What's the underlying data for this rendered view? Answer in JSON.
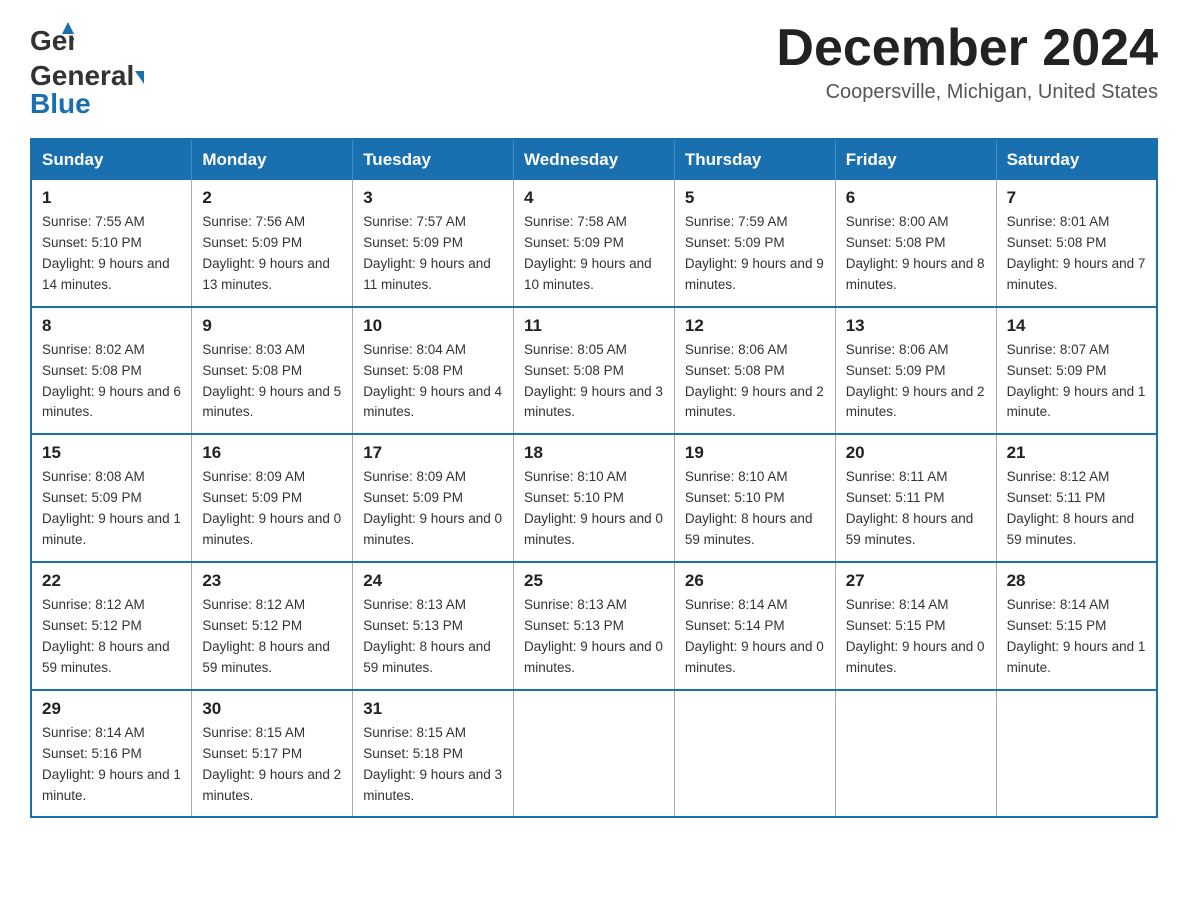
{
  "header": {
    "logo_general": "General",
    "logo_blue": "Blue",
    "month_title": "December 2024",
    "location": "Coopersville, Michigan, United States"
  },
  "weekdays": [
    "Sunday",
    "Monday",
    "Tuesday",
    "Wednesday",
    "Thursday",
    "Friday",
    "Saturday"
  ],
  "weeks": [
    [
      {
        "day": "1",
        "sunrise": "Sunrise: 7:55 AM",
        "sunset": "Sunset: 5:10 PM",
        "daylight": "Daylight: 9 hours and 14 minutes."
      },
      {
        "day": "2",
        "sunrise": "Sunrise: 7:56 AM",
        "sunset": "Sunset: 5:09 PM",
        "daylight": "Daylight: 9 hours and 13 minutes."
      },
      {
        "day": "3",
        "sunrise": "Sunrise: 7:57 AM",
        "sunset": "Sunset: 5:09 PM",
        "daylight": "Daylight: 9 hours and 11 minutes."
      },
      {
        "day": "4",
        "sunrise": "Sunrise: 7:58 AM",
        "sunset": "Sunset: 5:09 PM",
        "daylight": "Daylight: 9 hours and 10 minutes."
      },
      {
        "day": "5",
        "sunrise": "Sunrise: 7:59 AM",
        "sunset": "Sunset: 5:09 PM",
        "daylight": "Daylight: 9 hours and 9 minutes."
      },
      {
        "day": "6",
        "sunrise": "Sunrise: 8:00 AM",
        "sunset": "Sunset: 5:08 PM",
        "daylight": "Daylight: 9 hours and 8 minutes."
      },
      {
        "day": "7",
        "sunrise": "Sunrise: 8:01 AM",
        "sunset": "Sunset: 5:08 PM",
        "daylight": "Daylight: 9 hours and 7 minutes."
      }
    ],
    [
      {
        "day": "8",
        "sunrise": "Sunrise: 8:02 AM",
        "sunset": "Sunset: 5:08 PM",
        "daylight": "Daylight: 9 hours and 6 minutes."
      },
      {
        "day": "9",
        "sunrise": "Sunrise: 8:03 AM",
        "sunset": "Sunset: 5:08 PM",
        "daylight": "Daylight: 9 hours and 5 minutes."
      },
      {
        "day": "10",
        "sunrise": "Sunrise: 8:04 AM",
        "sunset": "Sunset: 5:08 PM",
        "daylight": "Daylight: 9 hours and 4 minutes."
      },
      {
        "day": "11",
        "sunrise": "Sunrise: 8:05 AM",
        "sunset": "Sunset: 5:08 PM",
        "daylight": "Daylight: 9 hours and 3 minutes."
      },
      {
        "day": "12",
        "sunrise": "Sunrise: 8:06 AM",
        "sunset": "Sunset: 5:08 PM",
        "daylight": "Daylight: 9 hours and 2 minutes."
      },
      {
        "day": "13",
        "sunrise": "Sunrise: 8:06 AM",
        "sunset": "Sunset: 5:09 PM",
        "daylight": "Daylight: 9 hours and 2 minutes."
      },
      {
        "day": "14",
        "sunrise": "Sunrise: 8:07 AM",
        "sunset": "Sunset: 5:09 PM",
        "daylight": "Daylight: 9 hours and 1 minute."
      }
    ],
    [
      {
        "day": "15",
        "sunrise": "Sunrise: 8:08 AM",
        "sunset": "Sunset: 5:09 PM",
        "daylight": "Daylight: 9 hours and 1 minute."
      },
      {
        "day": "16",
        "sunrise": "Sunrise: 8:09 AM",
        "sunset": "Sunset: 5:09 PM",
        "daylight": "Daylight: 9 hours and 0 minutes."
      },
      {
        "day": "17",
        "sunrise": "Sunrise: 8:09 AM",
        "sunset": "Sunset: 5:09 PM",
        "daylight": "Daylight: 9 hours and 0 minutes."
      },
      {
        "day": "18",
        "sunrise": "Sunrise: 8:10 AM",
        "sunset": "Sunset: 5:10 PM",
        "daylight": "Daylight: 9 hours and 0 minutes."
      },
      {
        "day": "19",
        "sunrise": "Sunrise: 8:10 AM",
        "sunset": "Sunset: 5:10 PM",
        "daylight": "Daylight: 8 hours and 59 minutes."
      },
      {
        "day": "20",
        "sunrise": "Sunrise: 8:11 AM",
        "sunset": "Sunset: 5:11 PM",
        "daylight": "Daylight: 8 hours and 59 minutes."
      },
      {
        "day": "21",
        "sunrise": "Sunrise: 8:12 AM",
        "sunset": "Sunset: 5:11 PM",
        "daylight": "Daylight: 8 hours and 59 minutes."
      }
    ],
    [
      {
        "day": "22",
        "sunrise": "Sunrise: 8:12 AM",
        "sunset": "Sunset: 5:12 PM",
        "daylight": "Daylight: 8 hours and 59 minutes."
      },
      {
        "day": "23",
        "sunrise": "Sunrise: 8:12 AM",
        "sunset": "Sunset: 5:12 PM",
        "daylight": "Daylight: 8 hours and 59 minutes."
      },
      {
        "day": "24",
        "sunrise": "Sunrise: 8:13 AM",
        "sunset": "Sunset: 5:13 PM",
        "daylight": "Daylight: 8 hours and 59 minutes."
      },
      {
        "day": "25",
        "sunrise": "Sunrise: 8:13 AM",
        "sunset": "Sunset: 5:13 PM",
        "daylight": "Daylight: 9 hours and 0 minutes."
      },
      {
        "day": "26",
        "sunrise": "Sunrise: 8:14 AM",
        "sunset": "Sunset: 5:14 PM",
        "daylight": "Daylight: 9 hours and 0 minutes."
      },
      {
        "day": "27",
        "sunrise": "Sunrise: 8:14 AM",
        "sunset": "Sunset: 5:15 PM",
        "daylight": "Daylight: 9 hours and 0 minutes."
      },
      {
        "day": "28",
        "sunrise": "Sunrise: 8:14 AM",
        "sunset": "Sunset: 5:15 PM",
        "daylight": "Daylight: 9 hours and 1 minute."
      }
    ],
    [
      {
        "day": "29",
        "sunrise": "Sunrise: 8:14 AM",
        "sunset": "Sunset: 5:16 PM",
        "daylight": "Daylight: 9 hours and 1 minute."
      },
      {
        "day": "30",
        "sunrise": "Sunrise: 8:15 AM",
        "sunset": "Sunset: 5:17 PM",
        "daylight": "Daylight: 9 hours and 2 minutes."
      },
      {
        "day": "31",
        "sunrise": "Sunrise: 8:15 AM",
        "sunset": "Sunset: 5:18 PM",
        "daylight": "Daylight: 9 hours and 3 minutes."
      },
      null,
      null,
      null,
      null
    ]
  ]
}
